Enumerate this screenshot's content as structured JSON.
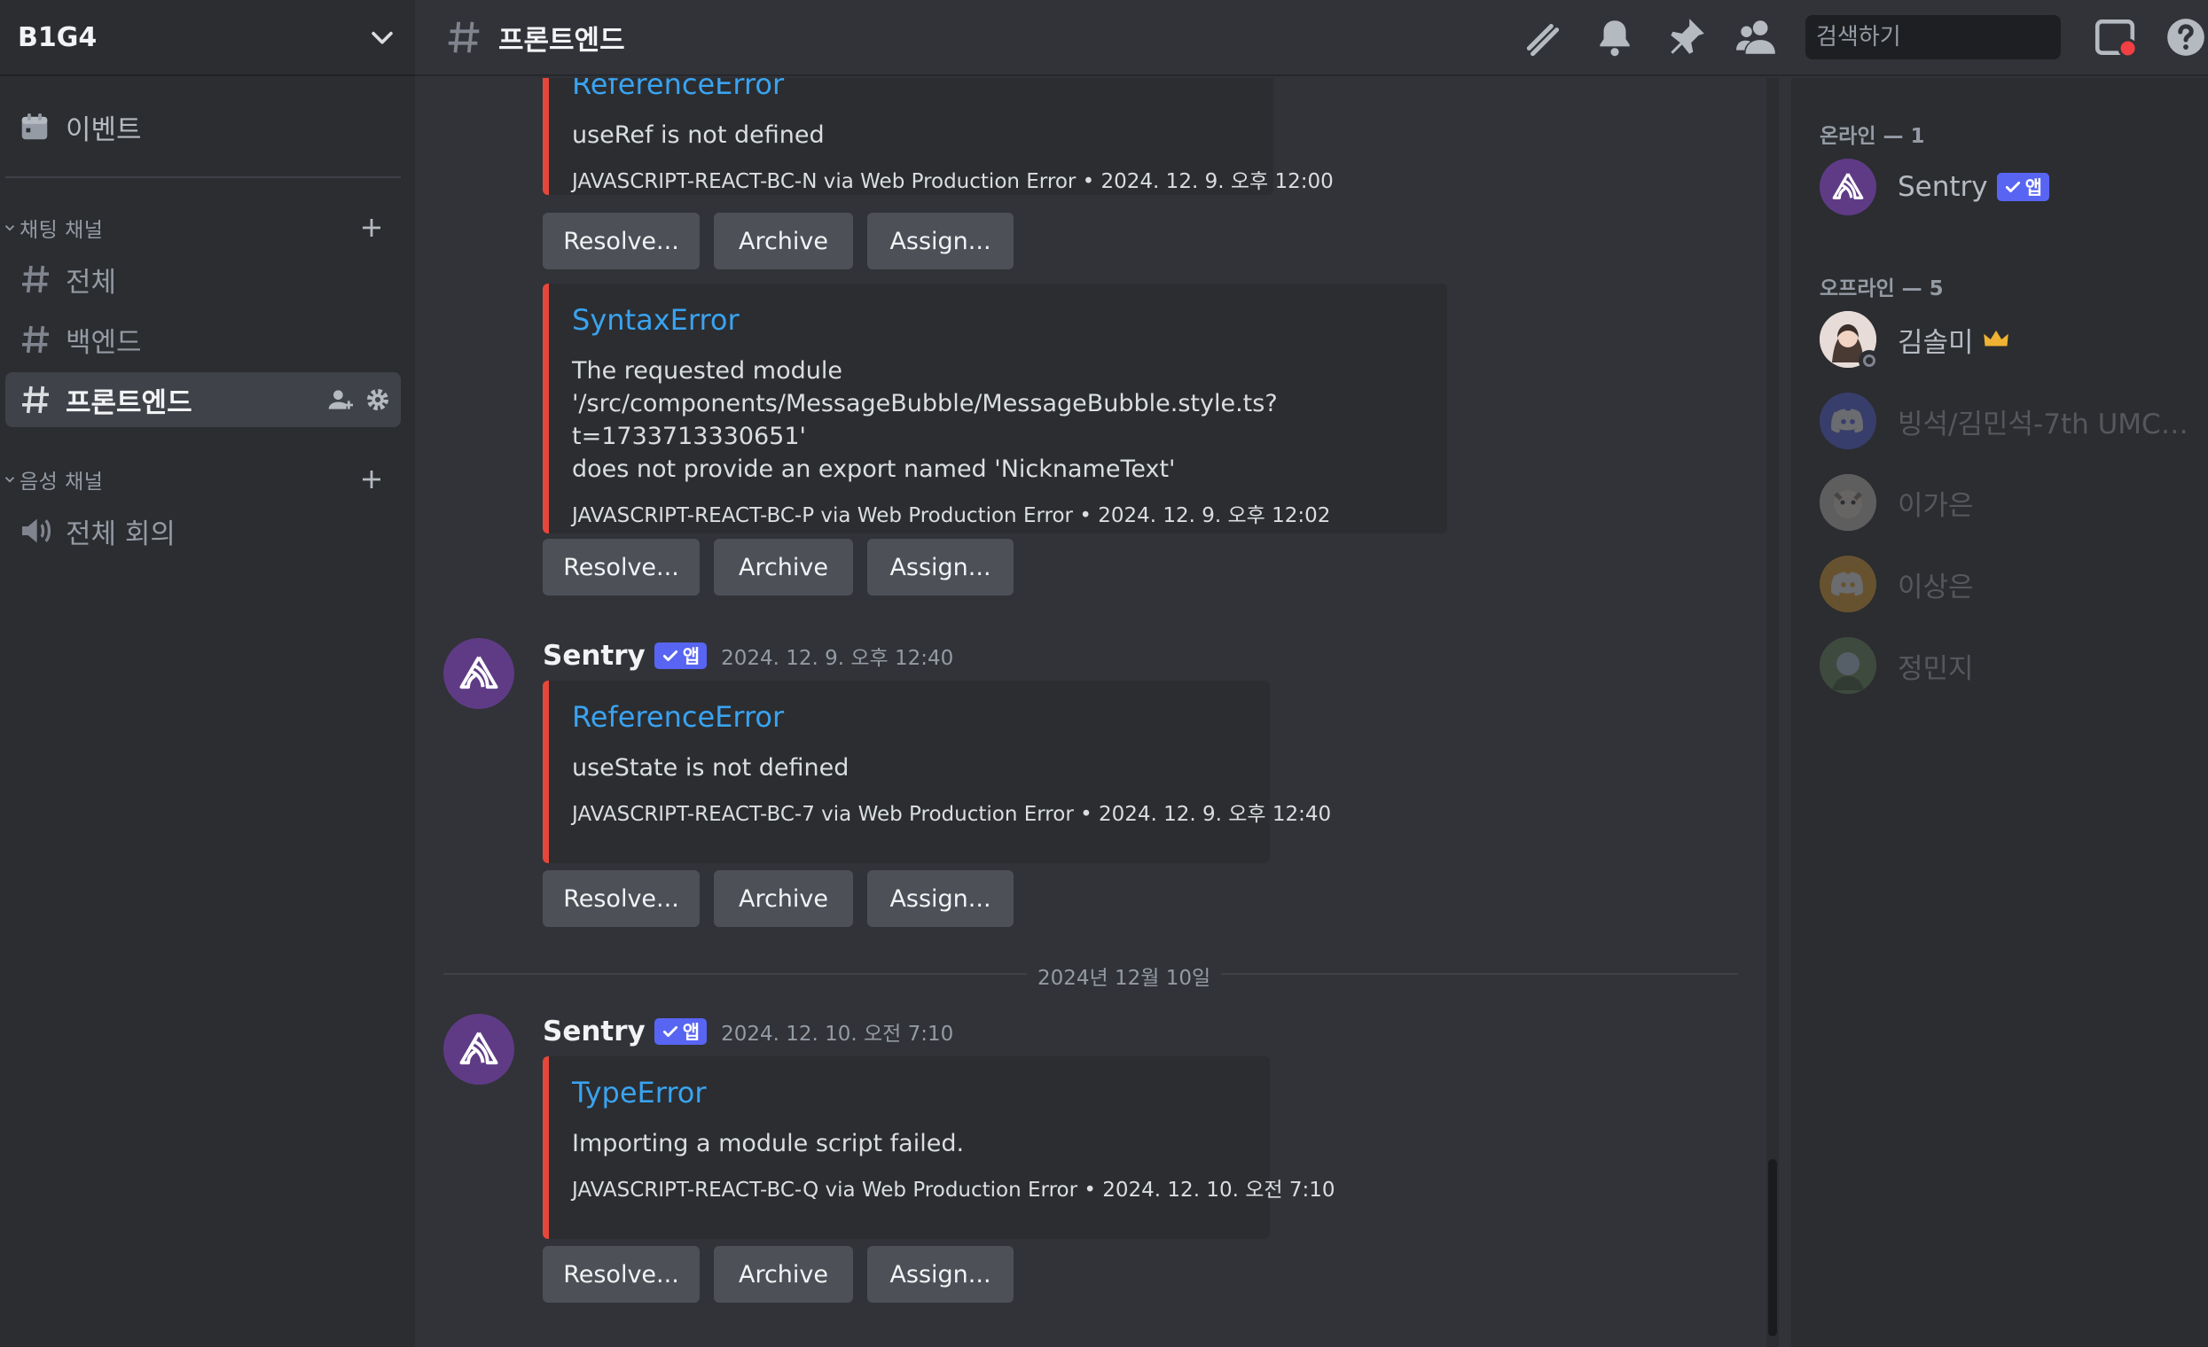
{
  "server": {
    "name": "B1G4"
  },
  "sidebar": {
    "events_label": "이벤트",
    "text_category": "채팅 채널",
    "voice_category": "음성 채널",
    "text_channels": [
      {
        "label": "전체"
      },
      {
        "label": "백엔드"
      },
      {
        "label": "프론트엔드"
      }
    ],
    "voice_channels": [
      {
        "label": "전체 회의"
      }
    ]
  },
  "header": {
    "channel": "프론트엔드",
    "search_placeholder": "검색하기"
  },
  "chat": {
    "app_badge": "앱",
    "buttons": {
      "resolve": "Resolve...",
      "archive": "Archive",
      "assign": "Assign..."
    },
    "date_divider": "2024년 12월 10일",
    "messages": [
      {
        "title": "ReferenceError",
        "description": "useRef is not defined",
        "footer": "JAVASCRIPT-REACT-BC-N via Web Production Error • 2024. 12. 9. 오후 12:00"
      },
      {
        "title": "SyntaxError",
        "description_lines": [
          "The requested module",
          "'/src/components/MessageBubble/MessageBubble.style.ts?t=1733713330651'",
          "does not provide an export named 'NicknameText'"
        ],
        "footer": "JAVASCRIPT-REACT-BC-P via Web Production Error • 2024. 12. 9. 오후 12:02"
      },
      {
        "author": "Sentry",
        "timestamp": "2024. 12. 9. 오후 12:40",
        "title": "ReferenceError",
        "description": "useState is not defined",
        "footer": "JAVASCRIPT-REACT-BC-7 via Web Production Error • 2024. 12. 9. 오후 12:40"
      },
      {
        "author": "Sentry",
        "timestamp": "2024. 12. 10. 오전 7:10",
        "title": "TypeError",
        "description": "Importing a module script failed.",
        "footer": "JAVASCRIPT-REACT-BC-Q via Web Production Error • 2024. 12. 10. 오전 7:10"
      }
    ]
  },
  "members": {
    "online_heading": "온라인 — 1",
    "offline_heading": "오프라인 — 5",
    "online": [
      {
        "name": "Sentry",
        "badge": "앱"
      }
    ],
    "offline": [
      {
        "name": "김솔미"
      },
      {
        "name": "빙석/김민석-7th UMC ..."
      },
      {
        "name": "이가은"
      },
      {
        "name": "이상은"
      },
      {
        "name": "정민지"
      }
    ]
  },
  "colors": {
    "accent": "#5865f2",
    "error_bar": "#e5473a",
    "link": "#3aa3f0",
    "crown": "#f0b232",
    "sentry_avatar": "#5f3b86"
  },
  "icons": [
    "calendar-icon",
    "chevron-down-icon",
    "hash-icon",
    "plus-icon",
    "add-member-icon",
    "gear-icon",
    "speaker-icon",
    "threads-icon",
    "bell-icon",
    "pin-icon",
    "members-icon",
    "search-icon",
    "inbox-icon",
    "help-icon",
    "sentry-logo-icon",
    "checkmark-icon",
    "crown-icon",
    "discord-logo-icon"
  ]
}
